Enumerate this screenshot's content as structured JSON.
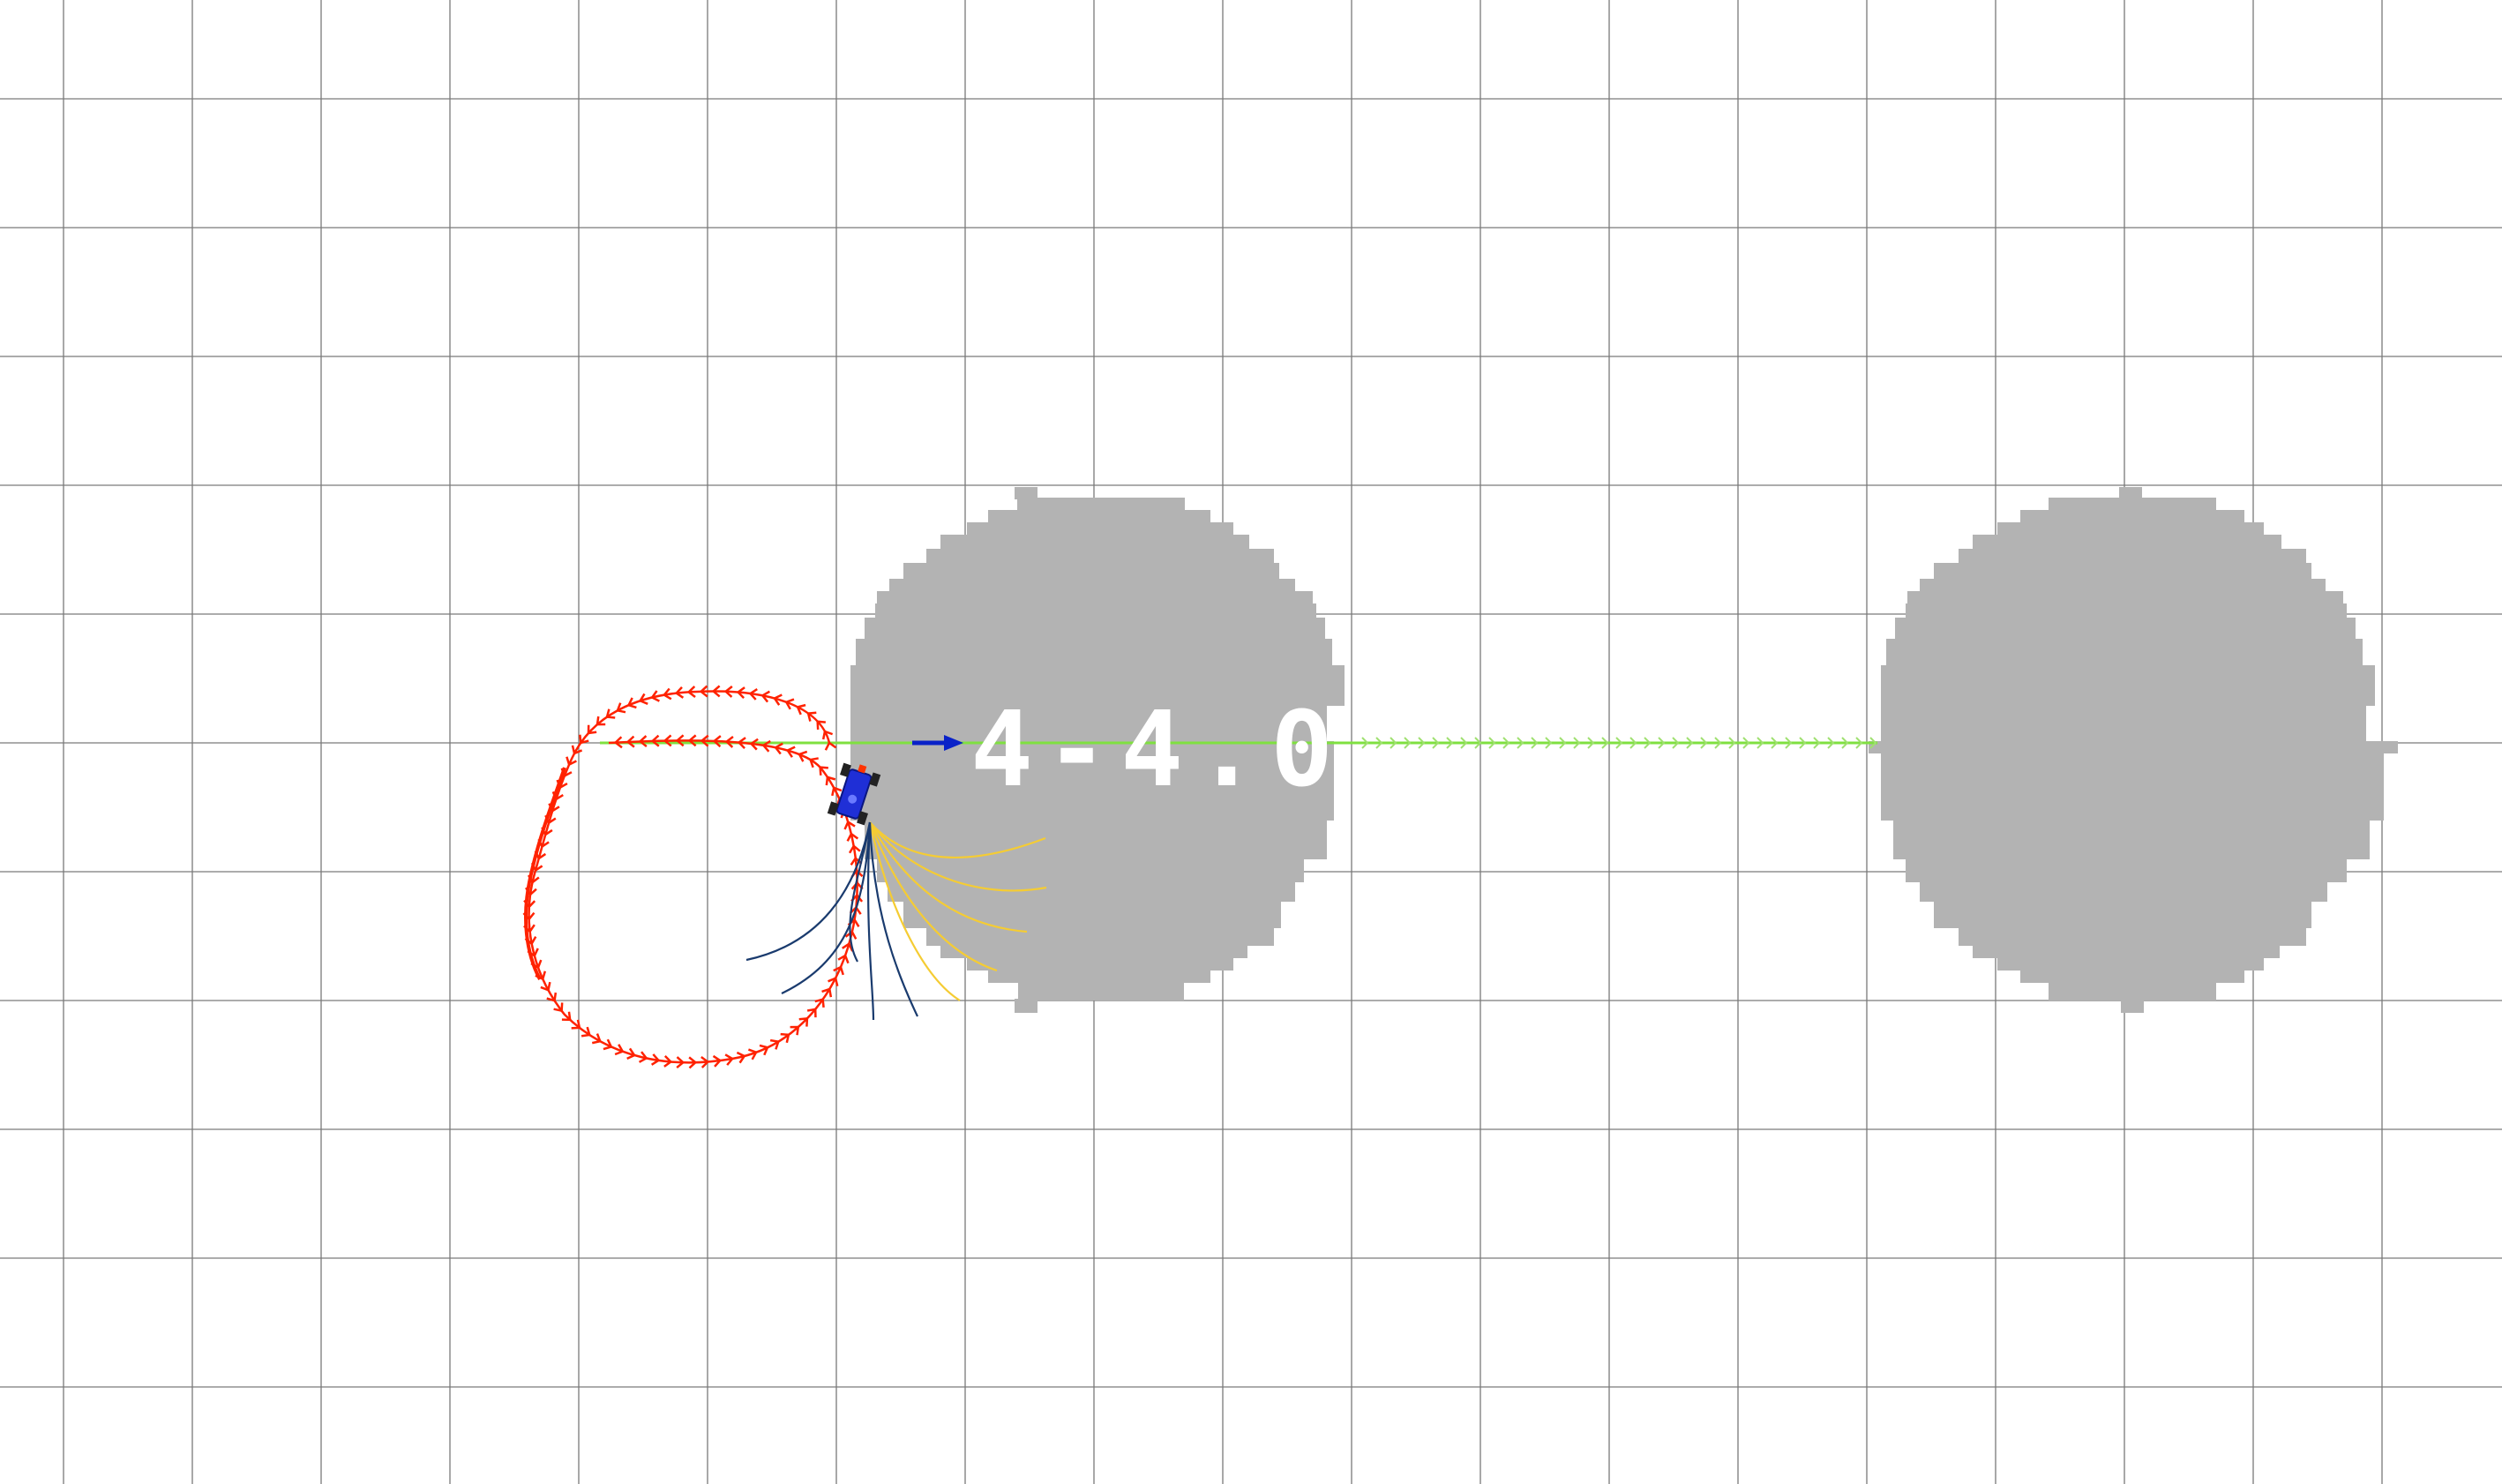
{
  "scene": {
    "overlay_text": "4-4.0",
    "colors": {
      "background": "#ffffff",
      "grid": "#7a7a7a",
      "obstacle": "#b3b3b3",
      "reference_path": "#7fe040",
      "robot_trail": "#ff2200",
      "candidate_good": "#f5cc33",
      "candidate_bad": "#1a3b6e",
      "goal_arrow": "#0a22c8",
      "robot_body": "#1f2fd6",
      "wheel": "#222222"
    },
    "icons": {
      "robot": "car-robot-icon",
      "goal": "goal-arrow-icon"
    }
  }
}
